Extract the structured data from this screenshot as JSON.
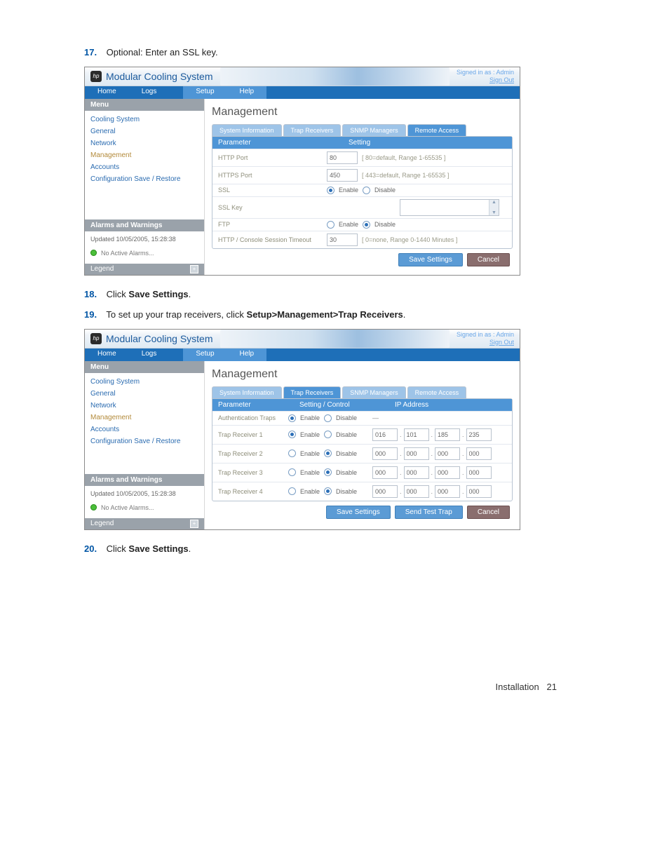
{
  "steps": {
    "s17": {
      "num": "17.",
      "text": "Optional: Enter an SSL key."
    },
    "s18": {
      "num": "18.",
      "pre": "Click ",
      "bold": "Save Settings",
      "post": "."
    },
    "s19": {
      "num": "19.",
      "pre": "To set up your trap receivers, click ",
      "bold": "Setup>Management>Trap Receivers",
      "post": "."
    },
    "s20": {
      "num": "20.",
      "pre": "Click ",
      "bold": "Save Settings",
      "post": "."
    }
  },
  "common": {
    "brand_badge": "hp",
    "brand_title": "Modular Cooling System",
    "signed_in": "Signed in as : Admin",
    "sign_out": "Sign Out",
    "nav_home": "Home",
    "nav_logs": "Logs",
    "nav_setup": "Setup",
    "nav_help": "Help",
    "menu_title": "Menu",
    "menu_items": {
      "cooling": "Cooling System",
      "general": "General",
      "network": "Network",
      "management": "Management",
      "accounts": "Accounts",
      "config": "Configuration Save / Restore"
    },
    "alarms_title": "Alarms and Warnings",
    "updated": "Updated 10/05/2005, 15:28:38",
    "no_alarms": "No Active Alarms...",
    "legend": "Legend",
    "page_title": "Management",
    "tabs": {
      "sysinfo": "System Information",
      "trap": "Trap Receivers",
      "snmp": "SNMP Managers",
      "remote": "Remote Access"
    },
    "enable": "Enable",
    "disable": "Disable",
    "save_btn": "Save Settings",
    "cancel_btn": "Cancel"
  },
  "shot1": {
    "headers": {
      "param": "Parameter",
      "setting": "Setting"
    },
    "rows": {
      "http_port": {
        "label": "HTTP Port",
        "value": "80",
        "hint": "[ 80=default, Range 1-65535 ]"
      },
      "https_port": {
        "label": "HTTPS Port",
        "value": "450",
        "hint": "[ 443=default, Range 1-65535 ]"
      },
      "ssl": {
        "label": "SSL"
      },
      "ssl_key": {
        "label": "SSL Key"
      },
      "ftp": {
        "label": "FTP"
      },
      "timeout": {
        "label": "HTTP / Console Session Timeout",
        "value": "30",
        "hint": "[ 0=none, Range 0-1440 Minutes ]"
      }
    }
  },
  "shot2": {
    "headers": {
      "param": "Parameter",
      "setting": "Setting / Control",
      "ip": "IP Address"
    },
    "send_trap_btn": "Send Test Trap",
    "rows": [
      {
        "label": "Authentication Traps",
        "enabled": true,
        "ip": null
      },
      {
        "label": "Trap Receiver 1",
        "enabled": true,
        "ip": [
          "016",
          "101",
          "185",
          "235"
        ]
      },
      {
        "label": "Trap Receiver 2",
        "enabled": false,
        "ip": [
          "000",
          "000",
          "000",
          "000"
        ]
      },
      {
        "label": "Trap Receiver 3",
        "enabled": false,
        "ip": [
          "000",
          "000",
          "000",
          "000"
        ]
      },
      {
        "label": "Trap Receiver 4",
        "enabled": false,
        "ip": [
          "000",
          "000",
          "000",
          "000"
        ]
      }
    ]
  },
  "footer": {
    "section": "Installation",
    "page": "21"
  }
}
